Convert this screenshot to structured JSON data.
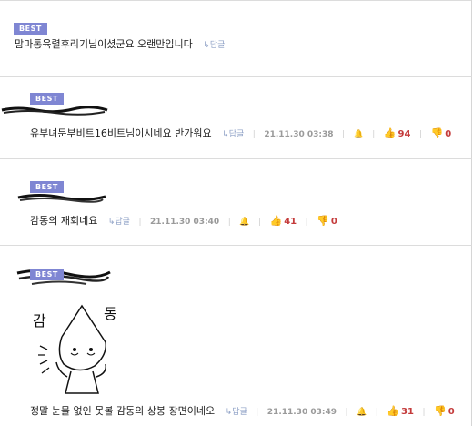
{
  "comments": [
    {
      "badge": "BEST",
      "text": "맘마통육렬후리기님이셨군요 오랜만입니다",
      "reply_label": "답글"
    },
    {
      "badge": "BEST",
      "text": "유부녀둔부비트16비트님이시네요 반가워요",
      "reply_label": "답글",
      "date": "21.11.30 03:38",
      "likes": "94",
      "dislikes": "0"
    },
    {
      "badge": "BEST",
      "text": "감동의 재회네요",
      "reply_label": "답글",
      "date": "21.11.30 03:40",
      "likes": "41",
      "dislikes": "0"
    },
    {
      "badge": "BEST",
      "text": "정말 눈물 없인 못볼 감동의 상봉 장면이네오",
      "reply_label": "답글",
      "date": "21.11.30 03:49",
      "likes": "31",
      "dislikes": "0",
      "image_caption": [
        "감",
        "동"
      ]
    }
  ],
  "colors": {
    "badge": "#7f86d3",
    "count": "#c43b3b",
    "thumb": "#4a6fc0"
  }
}
